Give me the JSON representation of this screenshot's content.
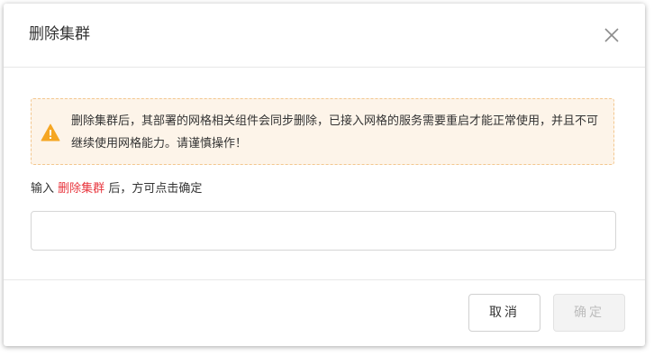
{
  "dialog": {
    "title": "删除集群",
    "close_icon": "close-icon"
  },
  "warning": {
    "icon": "warning-triangle-icon",
    "icon_color": "#f5a623",
    "text": "删除集群后，其部署的网格相关组件会同步删除，已接入网格的服务需要重启才能正常使用，并且不可继续使用网格能力。请谨慎操作！"
  },
  "instruction": {
    "prefix": "输入",
    "keyword": "删除集群",
    "suffix": "后，方可点击确定",
    "keyword_color": "#e8363e"
  },
  "confirm_input": {
    "value": "",
    "placeholder": ""
  },
  "footer": {
    "cancel_label": "取消",
    "confirm_label": "确定",
    "confirm_disabled": true
  }
}
